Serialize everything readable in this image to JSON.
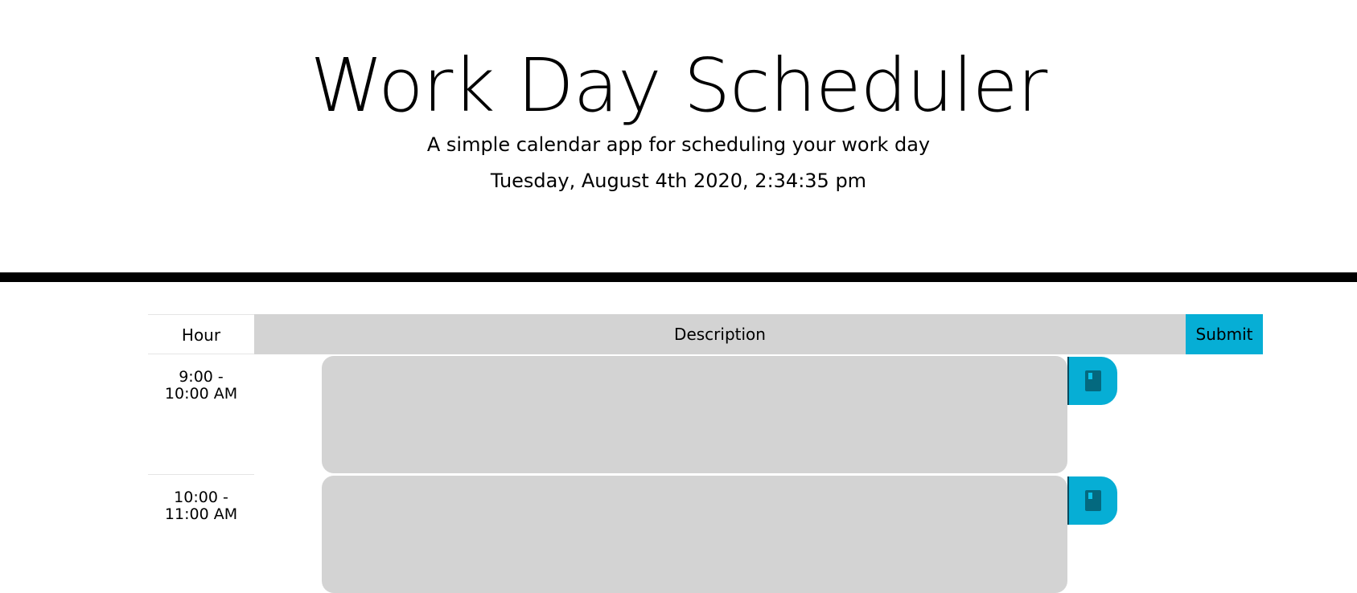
{
  "header": {
    "title": "Work Day Scheduler",
    "lead": "A simple calendar app for scheduling your work day",
    "current_day": "Tuesday, August 4th 2020, 2:34:35 pm"
  },
  "table": {
    "hour_header": "Hour",
    "description_header": "Description",
    "submit_label": "Submit"
  },
  "rows": [
    {
      "hour_line1": "9:00 -",
      "hour_line2": "10:00 AM",
      "description": ""
    },
    {
      "hour_line1": "10:00 -",
      "hour_line2": "11:00 AM",
      "description": ""
    }
  ],
  "colors": {
    "accent": "#06aed5",
    "description_bg": "#d3d3d3",
    "divider": "#000000"
  },
  "icons": {
    "save": "save-icon"
  }
}
